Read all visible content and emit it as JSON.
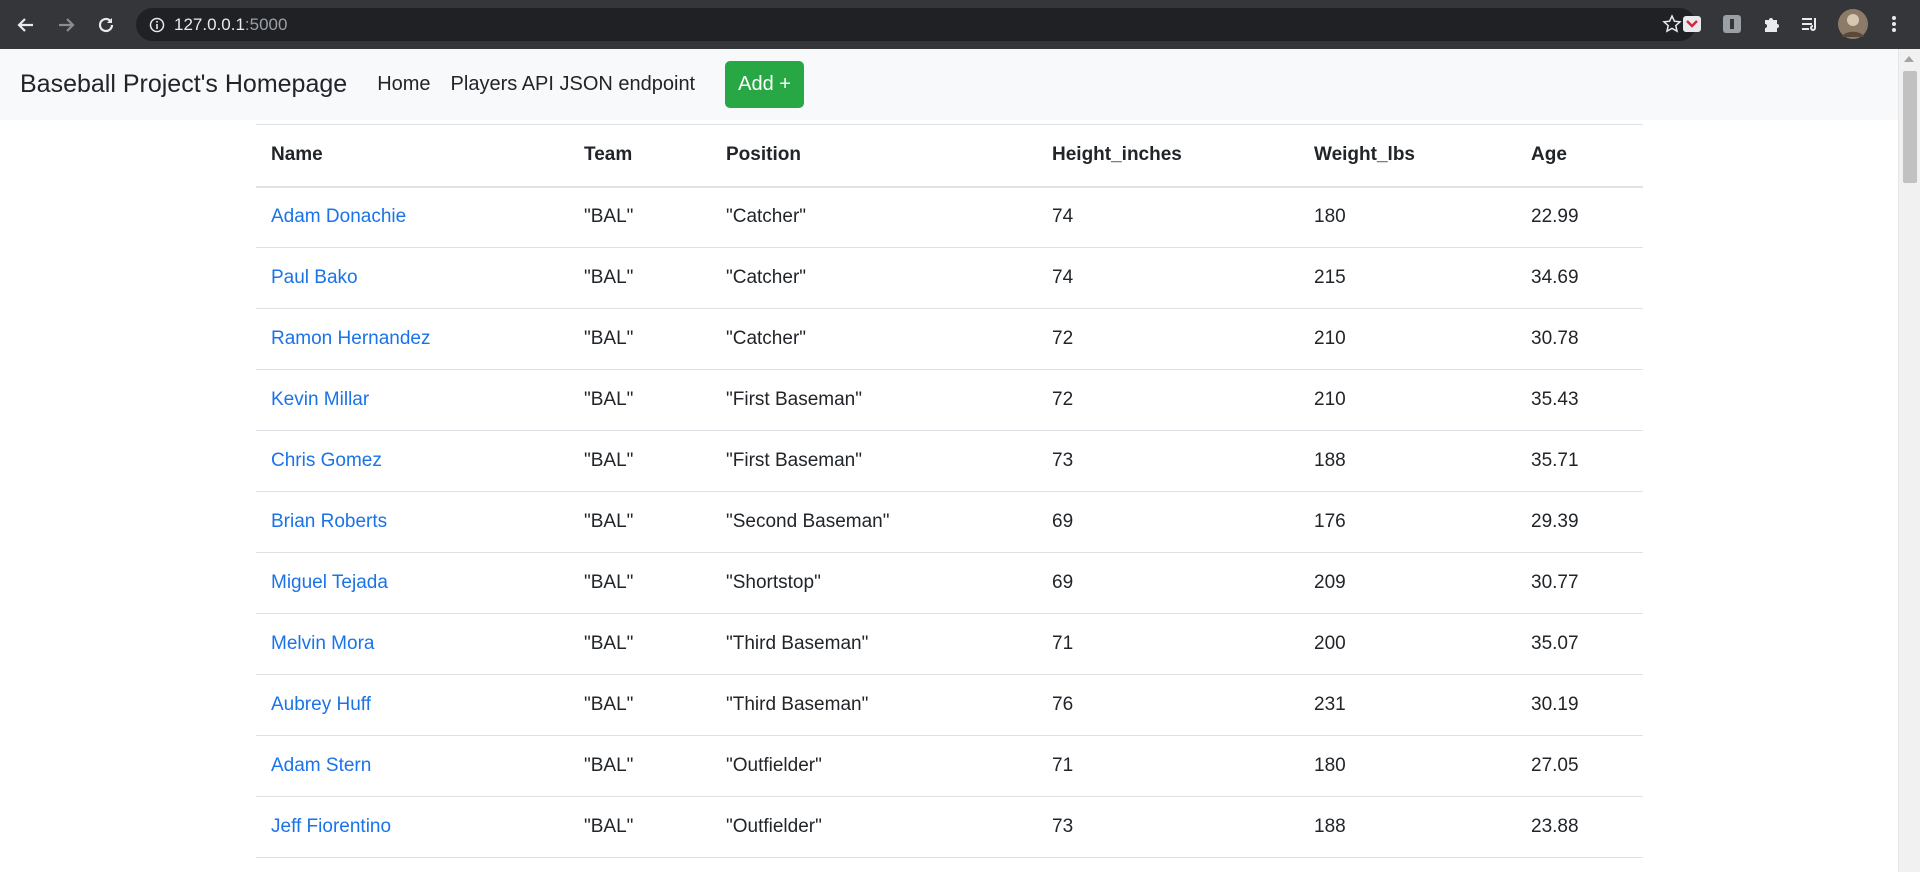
{
  "browser": {
    "url_host": "127.0.0.1",
    "url_port": ":5000"
  },
  "navbar": {
    "brand": "Baseball Project's Homepage",
    "links": [
      "Home",
      "Players API JSON endpoint"
    ],
    "add_button": "Add +"
  },
  "table": {
    "headers": [
      "Name",
      "Team",
      "Position",
      "Height_inches",
      "Weight_lbs",
      "Age"
    ],
    "rows": [
      [
        "Adam Donachie",
        "\"BAL\"",
        "\"Catcher\"",
        "74",
        "180",
        "22.99"
      ],
      [
        "Paul Bako",
        "\"BAL\"",
        "\"Catcher\"",
        "74",
        "215",
        "34.69"
      ],
      [
        "Ramon Hernandez",
        "\"BAL\"",
        "\"Catcher\"",
        "72",
        "210",
        "30.78"
      ],
      [
        "Kevin Millar",
        "\"BAL\"",
        "\"First Baseman\"",
        "72",
        "210",
        "35.43"
      ],
      [
        "Chris Gomez",
        "\"BAL\"",
        "\"First Baseman\"",
        "73",
        "188",
        "35.71"
      ],
      [
        "Brian Roberts",
        "\"BAL\"",
        "\"Second Baseman\"",
        "69",
        "176",
        "29.39"
      ],
      [
        "Miguel Tejada",
        "\"BAL\"",
        "\"Shortstop\"",
        "69",
        "209",
        "30.77"
      ],
      [
        "Melvin Mora",
        "\"BAL\"",
        "\"Third Baseman\"",
        "71",
        "200",
        "35.07"
      ],
      [
        "Aubrey Huff",
        "\"BAL\"",
        "\"Third Baseman\"",
        "76",
        "231",
        "30.19"
      ],
      [
        "Adam Stern",
        "\"BAL\"",
        "\"Outfielder\"",
        "71",
        "180",
        "27.05"
      ],
      [
        "Jeff Fiorentino",
        "\"BAL\"",
        "\"Outfielder\"",
        "73",
        "188",
        "23.88"
      ]
    ]
  },
  "colors": {
    "link": "#1a73e8",
    "add_button_bg": "#28a745",
    "navbar_bg": "#f8f9fa"
  }
}
